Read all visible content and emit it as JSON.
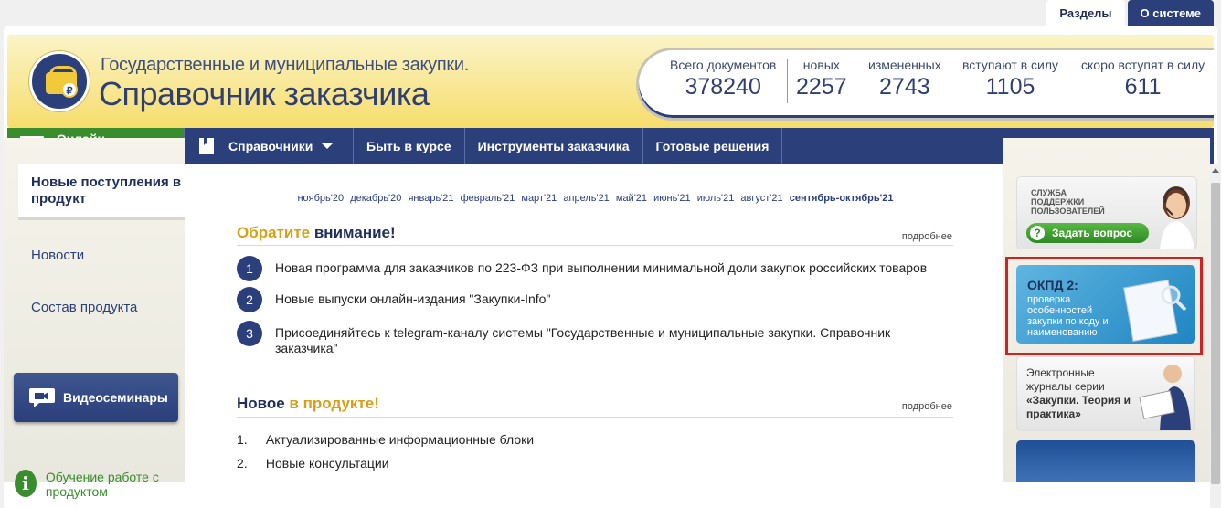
{
  "top_tabs": {
    "sections": "Разделы",
    "about": "О системе"
  },
  "brand": {
    "subtitle": "Государственные и муниципальные закупки.",
    "title": "Справочник заказчика",
    "logo_symbol": "₽"
  },
  "stats": [
    {
      "label": "Всего документов",
      "value": "378240"
    },
    {
      "label": "новых",
      "value": "2257"
    },
    {
      "label": "измененных",
      "value": "2743"
    },
    {
      "label": "вступают в силу",
      "value": "1105"
    },
    {
      "label": "скоро вступят в силу",
      "value": "611"
    }
  ],
  "menu": {
    "online": "Онлайн-услуги",
    "reference": "Справочники",
    "news": "Быть в курсе",
    "tools": "Инструменты заказчика",
    "solutions": "Готовые решения"
  },
  "left_nav": {
    "active": "Новые поступления в продукт",
    "news": "Новости",
    "structure": "Состав продукта",
    "video": "Видеосеминары",
    "learn": "Обучение работе с продуктом"
  },
  "months": [
    "ноябрь'20",
    "декабрь'20",
    "январь'21",
    "февраль'21",
    "март'21",
    "апрель'21",
    "май'21",
    "июнь'21",
    "июль'21",
    "август'21"
  ],
  "month_current": "сентябрь-октябрь'21",
  "attention": {
    "title_a": "Обратите",
    "title_b": "внимание!",
    "more": "подробнее",
    "items": [
      {
        "num": "1",
        "text": "Новая программа для заказчиков по 223-ФЗ при выполнении минимальной доли закупок российских товаров"
      },
      {
        "num": "2",
        "text": "Новые выпуски онлайн-издания \"Закупки-Info\""
      },
      {
        "num": "3",
        "text": "Присоединяйтесь к telegram-каналу системы \"Государственные и муниципальные закупки. Справочник заказчика\""
      }
    ]
  },
  "product_new": {
    "title_a": "Новое",
    "title_b": "в продукте!",
    "more": "подробнее",
    "items": [
      {
        "num": "1.",
        "text": "Актуализированные информационные блоки"
      },
      {
        "num": "2.",
        "text": "Новые консультации"
      }
    ]
  },
  "banners": {
    "support_label": "СЛУЖБА ПОДДЕРЖКИ ПОЛЬЗОВАТЕЛЕЙ",
    "ask": "Задать вопрос",
    "okpd_title": "ОКПД 2:",
    "okpd_sub": "проверка особенностей закупки по коду и наименованию",
    "journal_a": "Электронные журналы серии",
    "journal_b": "«Закупки. Теория и практика»"
  },
  "colors": {
    "navy": "#2b3f7a",
    "green": "#3a8d2e",
    "gold": "#d4a017",
    "highlight": "#d32020"
  }
}
